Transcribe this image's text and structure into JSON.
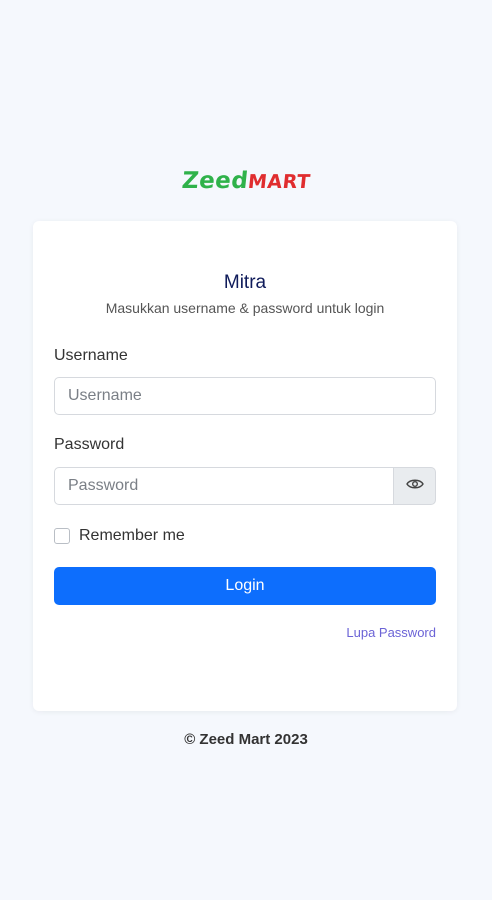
{
  "logo": {
    "part1": "Zeed",
    "part2": "MART",
    "colors": {
      "zeed": "#2fb24a",
      "mart": "#e02d2f"
    }
  },
  "card": {
    "title": "Mitra",
    "subtitle": "Masukkan username & password untuk login"
  },
  "form": {
    "username_label": "Username",
    "username_placeholder": "Username",
    "username_value": "",
    "password_label": "Password",
    "password_placeholder": "Password",
    "password_value": "",
    "password_toggle_icon": "eye-icon",
    "remember_label": "Remember me",
    "remember_checked": false,
    "login_label": "Login",
    "forgot_label": "Lupa Password"
  },
  "colors": {
    "primary": "#0d6efd",
    "link": "#6b63d6",
    "background": "#f5f8fd"
  },
  "footer": {
    "text": "© Zeed Mart 2023"
  }
}
